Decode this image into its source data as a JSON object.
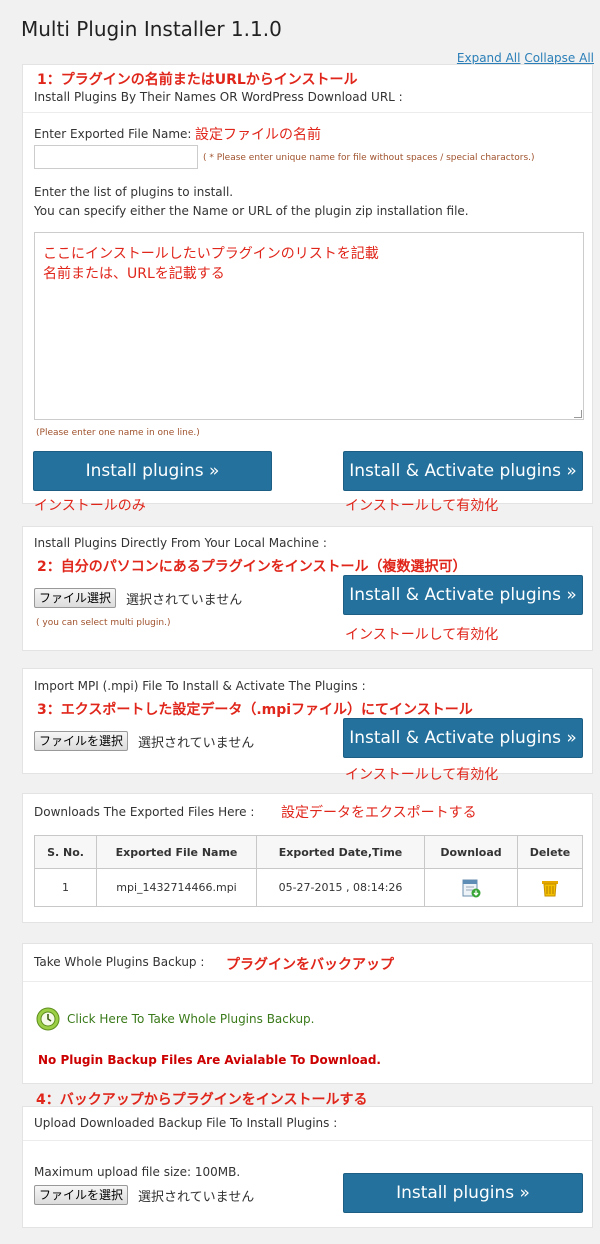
{
  "page": {
    "title": "Multi Plugin Installer 1.1.0",
    "expand_all": "Expand All",
    "collapse_all": "Collapse All"
  },
  "section1": {
    "annotation": "1：プラグインの名前またはURLからインストール",
    "heading": "Install Plugins By Their Names OR WordPress Download URL :",
    "file_name_label": "Enter Exported File Name:",
    "file_name_annotation": "設定ファイルの名前",
    "file_name_value": "",
    "file_name_note": "( * Please enter unique name for file without spaces / special charactors.)",
    "list_label_1": "Enter the list of plugins to install.",
    "list_label_2": "You can specify either the Name or URL of the plugin zip installation file.",
    "textarea_line_1": "ここにインストールしたいプラグインのリストを記載",
    "textarea_line_2": "名前または、URLを記載する",
    "textarea_note": "(Please enter one name in one line.)",
    "install_button": "Install plugins »",
    "install_activate_button": "Install & Activate plugins »",
    "install_annotation": "インストールのみ",
    "install_activate_annotation": "インストールして有効化"
  },
  "section2": {
    "heading": "Install Plugins Directly From Your Local Machine :",
    "annotation": "2：自分のパソコンにあるプラグインをインストール（複数選択可）",
    "file_button": "ファイル選択",
    "file_status": "選択されていません",
    "note": "( you can select multi plugin.)",
    "install_activate_button": "Install & Activate plugins »",
    "button_annotation": "インストールして有効化"
  },
  "section3": {
    "heading": "Import MPI (.mpi) File To Install & Activate The Plugins :",
    "annotation": "3：エクスポートした設定データ（.mpiファイル）にてインストール",
    "file_button": "ファイルを選択",
    "file_status": "選択されていません",
    "install_activate_button": "Install & Activate plugins »",
    "button_annotation": "インストールして有効化"
  },
  "section4": {
    "heading": "Downloads The Exported Files Here :",
    "annotation": "設定データをエクスポートする",
    "columns": [
      "S. No.",
      "Exported File Name",
      "Exported Date,Time",
      "Download",
      "Delete"
    ],
    "rows": [
      {
        "sno": "1",
        "file": "mpi_1432714466.mpi",
        "datetime": "05-27-2015 , 08:14:26"
      }
    ]
  },
  "section5": {
    "heading": "Take Whole Plugins Backup :",
    "annotation": "プラグインをバックアップ",
    "backup_link": "Click Here To Take Whole Plugins Backup.",
    "no_files": "No Plugin Backup Files Are Avialable To Download."
  },
  "section6": {
    "annotation": "4：バックアップからプラグインをインストールする",
    "heading": "Upload Downloaded Backup File To Install Plugins :",
    "max_size": "Maximum upload file size: 100MB.",
    "file_button": "ファイルを選択",
    "file_status": "選択されていません",
    "install_button": "Install plugins »"
  },
  "colors": {
    "button": "#23719c",
    "annotation": "#e0261b",
    "link": "#2a7fb8"
  }
}
